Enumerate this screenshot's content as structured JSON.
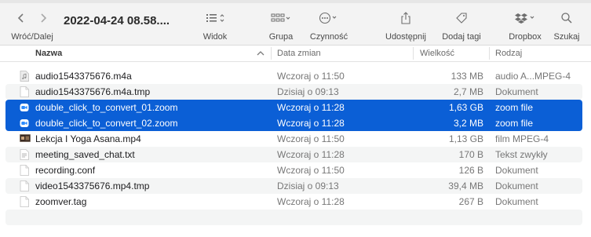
{
  "toolbar": {
    "nav_label": "Wróć/Dalej",
    "window_title": "2022-04-24 08.58....",
    "view_label": "Widok",
    "group_label": "Grupa",
    "action_label": "Czynność",
    "share_label": "Udostępnij",
    "tags_label": "Dodaj tagi",
    "dropbox_label": "Dropbox",
    "search_label": "Szukaj"
  },
  "columns": {
    "name": "Nazwa",
    "date": "Data zmian",
    "size": "Wielkość",
    "kind": "Rodzaj"
  },
  "files": [
    {
      "name": "audio1543375676.m4a",
      "date": "Wczoraj o 11:50",
      "size": "133 MB",
      "kind": "audio A...MPEG-4",
      "icon": "audio-file-icon",
      "selected": false
    },
    {
      "name": "audio1543375676.m4a.tmp",
      "date": "Dzisiaj o 09:13",
      "size": "2,7 MB",
      "kind": "Dokument",
      "icon": "document-icon",
      "selected": false
    },
    {
      "name": "double_click_to_convert_01.zoom",
      "date": "Wczoraj o 11:28",
      "size": "1,63 GB",
      "kind": "zoom file",
      "icon": "zoom-file-icon",
      "selected": true
    },
    {
      "name": "double_click_to_convert_02.zoom",
      "date": "Wczoraj o 11:28",
      "size": "3,2 MB",
      "kind": "zoom file",
      "icon": "zoom-file-icon",
      "selected": true
    },
    {
      "name": "Lekcja I Yoga Asana.mp4",
      "date": "Wczoraj o 11:50",
      "size": "1,13 GB",
      "kind": "film MPEG-4",
      "icon": "video-thumbnail-icon",
      "selected": false
    },
    {
      "name": "meeting_saved_chat.txt",
      "date": "Wczoraj o 11:28",
      "size": "170 B",
      "kind": "Tekst zwykły",
      "icon": "text-file-icon",
      "selected": false
    },
    {
      "name": "recording.conf",
      "date": "Wczoraj o 11:50",
      "size": "126 B",
      "kind": "Dokument",
      "icon": "document-icon",
      "selected": false
    },
    {
      "name": "video1543375676.mp4.tmp",
      "date": "Dzisiaj o 09:13",
      "size": "39,4 MB",
      "kind": "Dokument",
      "icon": "document-icon",
      "selected": false
    },
    {
      "name": "zoomver.tag",
      "date": "Wczoraj o 11:28",
      "size": "267 B",
      "kind": "Dokument",
      "icon": "document-icon",
      "selected": false
    }
  ],
  "colors": {
    "selection": "#0b5fd6",
    "zoom_icon": "#2d8cff"
  }
}
